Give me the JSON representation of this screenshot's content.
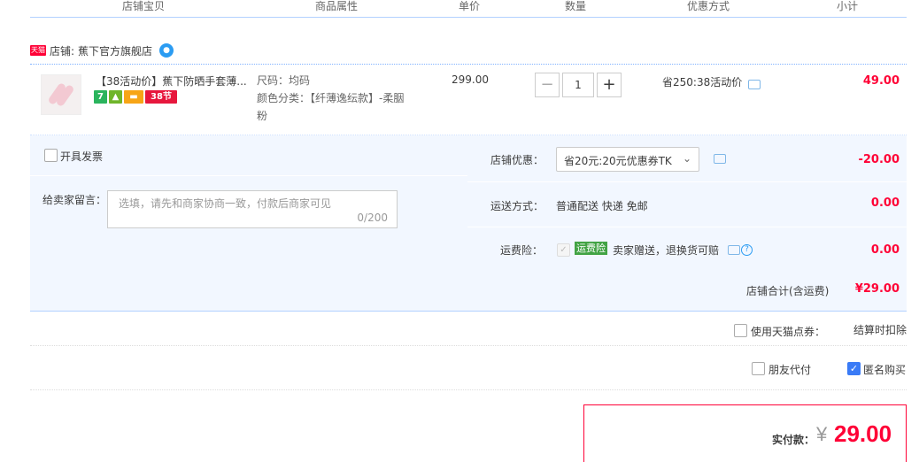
{
  "header": {
    "columns": [
      "店铺宝贝",
      "商品属性",
      "单价",
      "数量",
      "优惠方式",
      "小计"
    ]
  },
  "shop": {
    "badge_text": "天猫",
    "label": "店铺:",
    "name": "蕉下官方旗舰店"
  },
  "item": {
    "title": "【38活动价】蕉下防晒手套薄...",
    "badges": [
      "7",
      "",
      "",
      "38节"
    ],
    "attr_size": "尺码：均码",
    "attr_color_line1": "颜色分类：【纤薄逸纭款】-柔胭",
    "attr_color_line2": "粉",
    "price": "299.00",
    "quantity": "1",
    "qty_minus": "−",
    "qty_plus": "+",
    "promo": "省250:38活动价",
    "subtotal": "49.00"
  },
  "options": {
    "invoice_label": "开具发票",
    "memo_label": "给卖家留言：",
    "memo_placeholder": "选填，请先和商家协商一致，付款后商家可见",
    "memo_counter": "0/200",
    "coupon_label": "店铺优惠：",
    "coupon_value": "省20元:20元优惠券TK",
    "coupon_amount": "-20.00",
    "shipping_label": "运送方式：",
    "shipping_value": "普通配送 快递 免邮",
    "shipping_amount": "0.00",
    "insurance_label": "运费险：",
    "insurance_tag": "运费险",
    "insurance_text": "卖家赠送，退换货可赔",
    "insurance_amount": "0.00",
    "shop_total_label": "店铺合计(含运费)",
    "shop_total_value": "¥29.00"
  },
  "points": {
    "label": "使用天猫点券：",
    "value": "结算时扣除"
  },
  "pay_options": {
    "friend_pay": "朋友代付",
    "anonymous": "匿名购买",
    "anonymous_checked": true
  },
  "total": {
    "label": "实付款：",
    "currency": "¥",
    "amount": "29.00"
  },
  "colors": {
    "accent_red": "#ff0036",
    "panel_bg": "#f2f7ff",
    "checkbox_blue": "#3a7bf6"
  }
}
